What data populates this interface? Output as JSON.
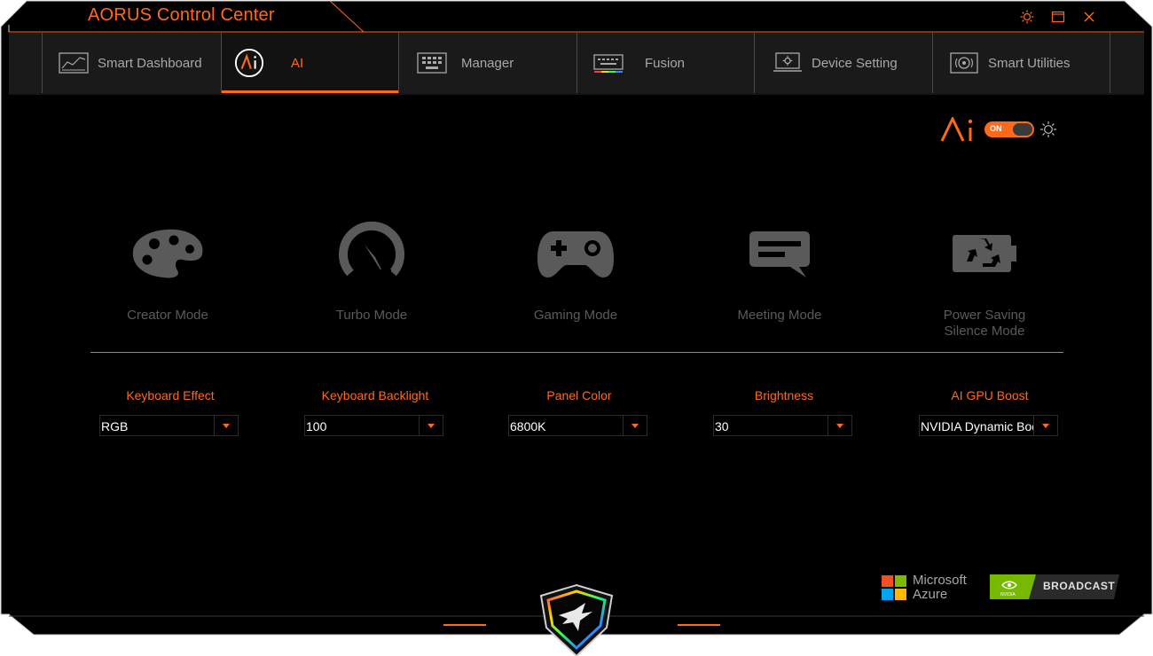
{
  "window": {
    "title": "AORUS Control Center"
  },
  "colors": {
    "accent": "#ff6a1a",
    "background": "#000000",
    "muted_text": "#5a5a5a",
    "tab_text": "#a8a8a8"
  },
  "tabs": [
    {
      "label": "Smart Dashboard",
      "icon": "dashboard-icon"
    },
    {
      "label": "AI",
      "icon": "ai-logo-icon",
      "active": true
    },
    {
      "label": "Manager",
      "icon": "manager-icon"
    },
    {
      "label": "Fusion",
      "icon": "fusion-keyboard-icon"
    },
    {
      "label": "Device Setting",
      "icon": "device-setting-icon"
    },
    {
      "label": "Smart Utilities",
      "icon": "smart-utilities-icon"
    }
  ],
  "ai_toggle": {
    "state": "ON"
  },
  "modes": [
    {
      "label": "Creator Mode",
      "icon": "palette-icon"
    },
    {
      "label": "Turbo Mode",
      "icon": "speedometer-icon"
    },
    {
      "label": "Gaming Mode",
      "icon": "gamepad-icon"
    },
    {
      "label": "Meeting Mode",
      "icon": "chat-bubble-icon"
    },
    {
      "label_line1": "Power Saving",
      "label_line2": "Silence Mode",
      "icon": "recycle-battery-icon"
    }
  ],
  "settings": [
    {
      "label": "Keyboard Effect",
      "value": "RGB"
    },
    {
      "label": "Keyboard Backlight",
      "value": "100"
    },
    {
      "label": "Panel Color",
      "value": "6800K"
    },
    {
      "label": "Brightness",
      "value": "30"
    },
    {
      "label": "AI GPU Boost",
      "value": "NVIDIA Dynamic Boost"
    }
  ],
  "partners": {
    "microsoft_line1": "Microsoft",
    "microsoft_line2": "Azure",
    "nvidia_small": "NVIDIA",
    "broadcast": "BROADCAST"
  }
}
